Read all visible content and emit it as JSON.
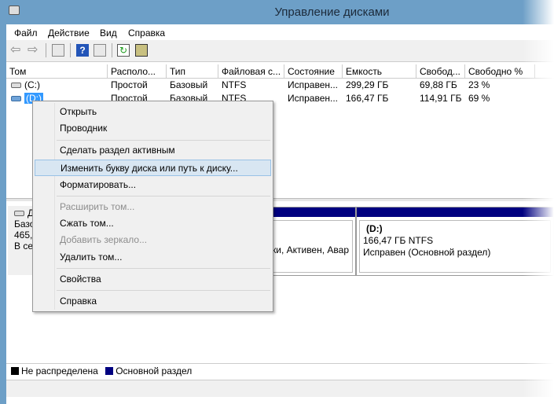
{
  "window": {
    "title": "Управление дисками"
  },
  "menu": [
    "Файл",
    "Действие",
    "Вид",
    "Справка"
  ],
  "toolbar": [
    "back-icon",
    "forward-icon",
    "console-tree-icon",
    "help-icon",
    "action-pane-icon",
    "refresh-icon",
    "properties-icon"
  ],
  "table": {
    "columns": [
      "Том",
      "Располо...",
      "Тип",
      "Файловая с...",
      "Состояние",
      "Емкость",
      "Свобод...",
      "Свободно %"
    ],
    "rows": [
      [
        "(C:)",
        "Простой",
        "Базовый",
        "NTFS",
        "Исправен...",
        "299,29 ГБ",
        "69,88 ГБ",
        "23 %"
      ],
      [
        "(D:)",
        "Простой",
        "Базовый",
        "NTFS",
        "Исправен...",
        "166,47 ГБ",
        "114,91 ГБ",
        "69 %"
      ]
    ]
  },
  "disk": {
    "name": "Д",
    "type": "Базо",
    "size": "465,",
    "status": "В се"
  },
  "partitions": [
    {
      "text": "нки, Активен, Авар"
    },
    {
      "name": "(D:)",
      "size": "166,47 ГБ NTFS",
      "status": "Исправен (Основной раздел)"
    }
  ],
  "legend": [
    {
      "label": "Не распределена",
      "color": "#000000"
    },
    {
      "label": "Основной раздел",
      "color": "#000080"
    }
  ],
  "context_menu": [
    {
      "label": "Открыть",
      "disabled": false
    },
    {
      "label": "Проводник",
      "disabled": false
    },
    {
      "label": "Сделать раздел активным",
      "disabled": false
    },
    {
      "label": "Изменить букву диска или путь к диску...",
      "disabled": false,
      "highlighted": true
    },
    {
      "label": "Форматировать...",
      "disabled": false
    },
    {
      "label": "Расширить том...",
      "disabled": true
    },
    {
      "label": "Сжать том...",
      "disabled": false
    },
    {
      "label": "Добавить зеркало...",
      "disabled": true
    },
    {
      "label": "Удалить том...",
      "disabled": false
    },
    {
      "label": "Свойства",
      "disabled": false
    },
    {
      "label": "Справка",
      "disabled": false
    }
  ]
}
